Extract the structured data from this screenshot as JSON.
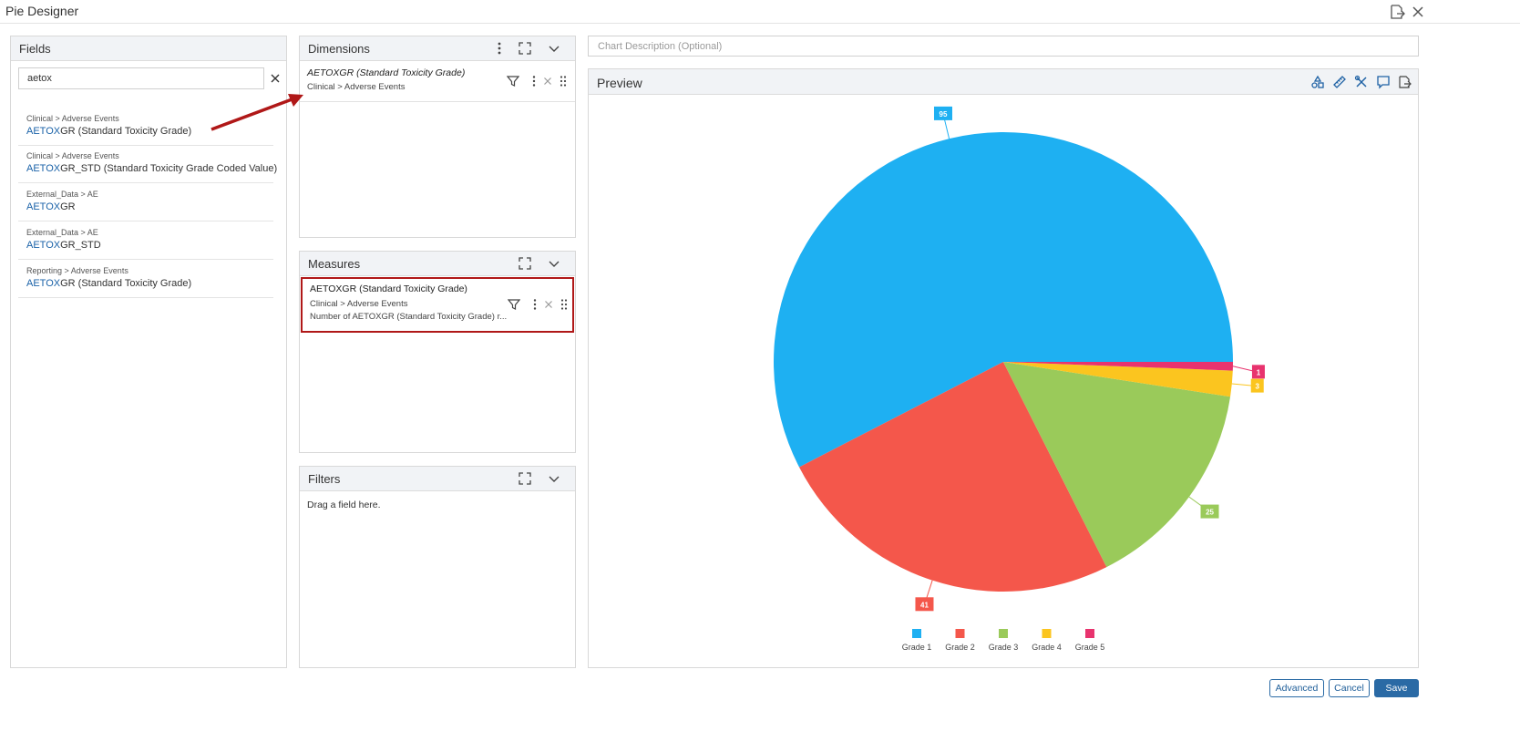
{
  "window": {
    "title": "Pie Designer"
  },
  "fields": {
    "title": "Fields",
    "search_value": "aetox",
    "items": [
      {
        "path": "Clinical > Adverse Events",
        "highlight": "AETOX",
        "rest": "GR (Standard Toxicity Grade)"
      },
      {
        "path": "Clinical > Adverse Events",
        "highlight": "AETOX",
        "rest": "GR_STD (Standard Toxicity Grade Coded Value)"
      },
      {
        "path": "External_Data > AE",
        "highlight": "AETOX",
        "rest": "GR"
      },
      {
        "path": "External_Data > AE",
        "highlight": "AETOX",
        "rest": "GR_STD"
      },
      {
        "path": "Reporting > Adverse Events",
        "highlight": "AETOX",
        "rest": "GR (Standard Toxicity Grade)"
      }
    ]
  },
  "dimensions": {
    "title": "Dimensions",
    "item": {
      "name": "AETOXGR (Standard Toxicity Grade)",
      "path": "Clinical > Adverse Events"
    }
  },
  "measures": {
    "title": "Measures",
    "item": {
      "name": "AETOXGR (Standard Toxicity Grade)",
      "path": "Clinical > Adverse Events",
      "detail": "Number of AETOXGR (Standard Toxicity Grade) r..."
    }
  },
  "filters": {
    "title": "Filters",
    "placeholder": "Drag a field here."
  },
  "description": {
    "placeholder": "Chart Description (Optional)"
  },
  "preview": {
    "title": "Preview"
  },
  "buttons": {
    "advanced": "Advanced",
    "cancel": "Cancel",
    "save": "Save"
  },
  "colors": {
    "accent": "#2a6aa5",
    "annotation": "#b01818"
  },
  "chart_data": {
    "type": "pie",
    "categories": [
      "Grade 1",
      "Grade 2",
      "Grade 3",
      "Grade 4",
      "Grade 5"
    ],
    "values": [
      95,
      41,
      25,
      3,
      1
    ],
    "colors": [
      "#1eb0f2",
      "#f4574b",
      "#9aca5a",
      "#fbc51f",
      "#e8336e"
    ],
    "legend": "bottom"
  }
}
